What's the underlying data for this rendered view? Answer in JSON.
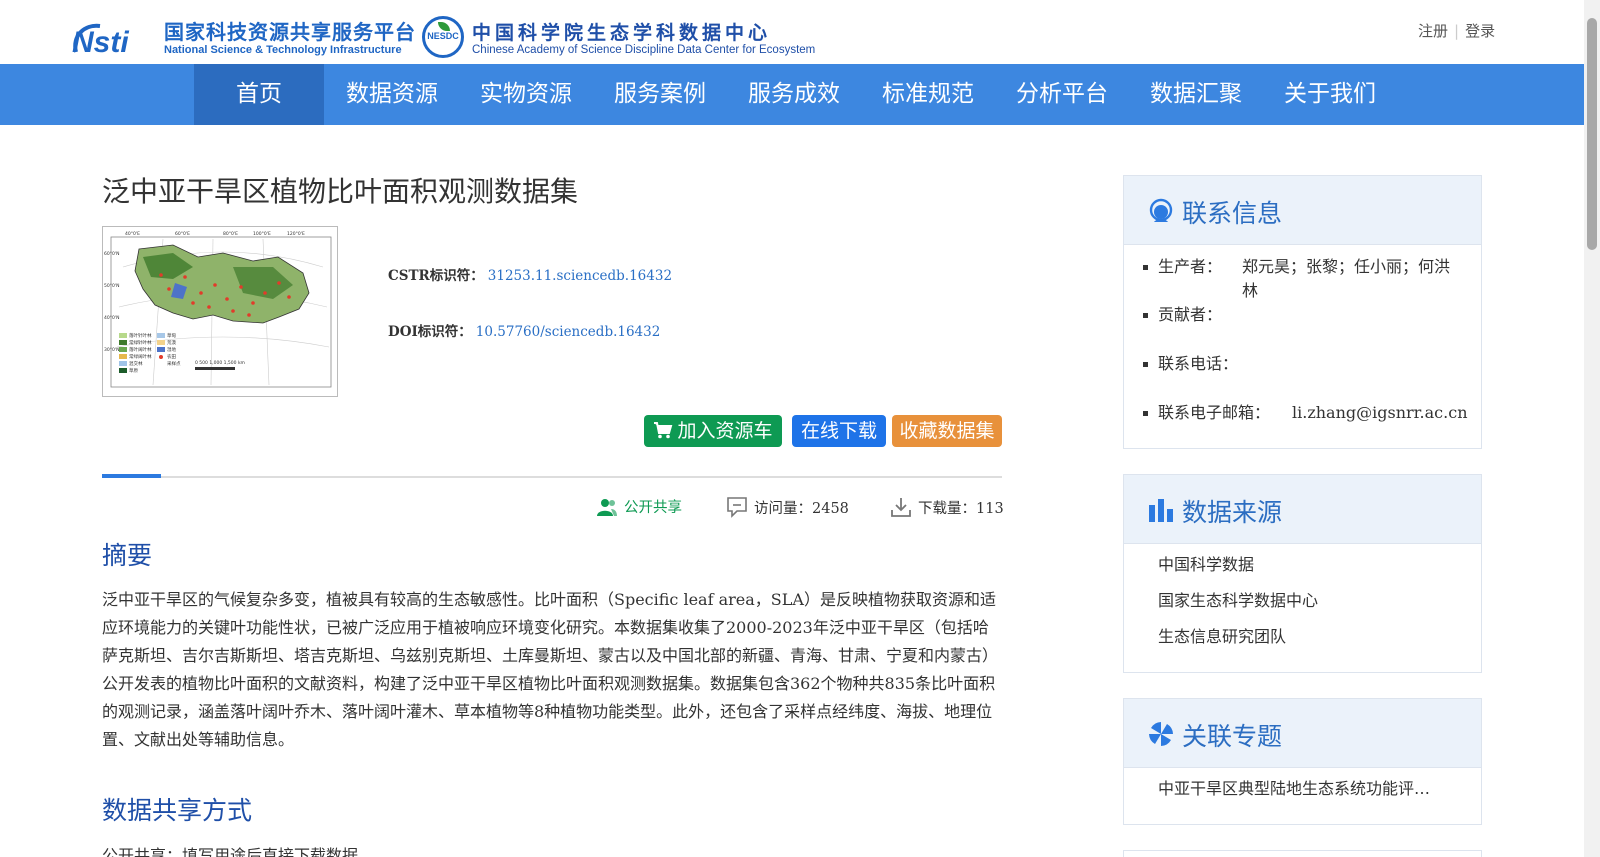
{
  "header": {
    "platform_logo_mark": "Nsti",
    "platform_name_cn": "国家科技资源共享服务平台",
    "platform_name_en": "National Science & Technology Infrastructure",
    "center_seal": "NESDC",
    "center_name_cn": "中国科学院生态学科数据中心",
    "center_name_en": "Chinese Academy of Science Discipline Data Center for Ecosystem",
    "register_label": "注册",
    "login_label": "登录"
  },
  "nav": {
    "items": [
      "首页",
      "数据资源",
      "实物资源",
      "服务案例",
      "服务成效",
      "标准规范",
      "分析平台",
      "数据汇聚",
      "关于我们"
    ],
    "active_index": 0
  },
  "dataset": {
    "title": "泛中亚干旱区植物比叶面积观测数据集",
    "cstr_label": "CSTR标识符：",
    "cstr_value": "31253.11.sciencedb.16432",
    "doi_label": "DOI标识符：",
    "doi_value": "10.57760/sciencedb.16432",
    "buttons": {
      "cart": "加入资源车",
      "download": "在线下载",
      "favorite": "收藏数据集"
    },
    "stats": {
      "share": "公开共享",
      "visits": "访问量：2458",
      "downloads": "下载量：113"
    },
    "abstract_heading": "摘要",
    "abstract": "泛中亚干旱区的气候复杂多变，植被具有较高的生态敏感性。比叶面积（Specific leaf area，SLA）是反映植物获取资源和适应环境能力的关键叶功能性状，已被广泛应用于植被响应环境变化研究。本数据集收集了2000-2023年泛中亚干旱区（包括哈萨克斯坦、吉尔吉斯斯坦、塔吉克斯坦、乌兹别克斯坦、土库曼斯坦、蒙古以及中国北部的新疆、青海、甘肃、宁夏和内蒙古）公开发表的植物比叶面积的文献资料，构建了泛中亚干旱区植物比叶面积观测数据集。数据集包含362个物种共835条比叶面积的观测记录，涵盖落叶阔叶乔木、落叶阔叶灌木、草本植物等8种植物功能类型。此外，还包含了采样点经纬度、海拔、地理位置、文献出处等辅助信息。",
    "sharing_heading": "数据共享方式",
    "sharing_text": "公开共享：填写用途后直接下载数据"
  },
  "thumbnail": {
    "lon_labels": [
      "40°0'E",
      "60°0'E",
      "80°0'E",
      "100°0'E",
      "120°0'E"
    ],
    "lat_labels": [
      "60°0'N",
      "50°0'N",
      "40°0'N",
      "30°0'N"
    ],
    "legend": [
      "落叶针叶林",
      "常绿针叶林",
      "落叶阔叶林",
      "常绿阔叶林",
      "混交林",
      "草原",
      "草甸",
      "荒漠",
      "湿地",
      "农田",
      "采样点"
    ],
    "scale": "0 500 1,000 1,500 km",
    "colors": {
      "land": "#8fb36a",
      "dark": "#3e7a2c",
      "point": "#e23b2a",
      "water": "#4d73c9"
    }
  },
  "sidebar": {
    "contact": {
      "title": "联系信息",
      "rows": [
        {
          "key": "生产者：",
          "value": "郑元昊；张黎；任小丽；何洪林"
        },
        {
          "key": "贡献者：",
          "value": ""
        },
        {
          "key": "联系电话：",
          "value": ""
        },
        {
          "key": "联系电子邮箱：",
          "value": "li.zhang@igsnrr.ac.cn"
        }
      ]
    },
    "source": {
      "title": "数据来源",
      "items": [
        "中国科学数据",
        "国家生态科学数据中心",
        "生态信息研究团队"
      ]
    },
    "topic": {
      "title": "关联专题",
      "items": [
        "中亚干旱区典型陆地生态系统功能评…"
      ]
    }
  },
  "colors": {
    "nav_bg": "#3d87e0",
    "nav_active": "#2c6cbf",
    "accent_blue": "#1f4fa8",
    "btn_green": "#0e9a53",
    "btn_blue": "#1e73e8",
    "btn_orange": "#e8913b",
    "panel_head_bg": "#ebf2fa"
  },
  "icons": {
    "cart": "shopping-cart-icon",
    "share": "users-icon",
    "visits": "comment-icon",
    "downloads": "download-icon",
    "contact": "headset-user-icon",
    "source": "bar-chart-icon",
    "topic": "pinwheel-icon"
  }
}
